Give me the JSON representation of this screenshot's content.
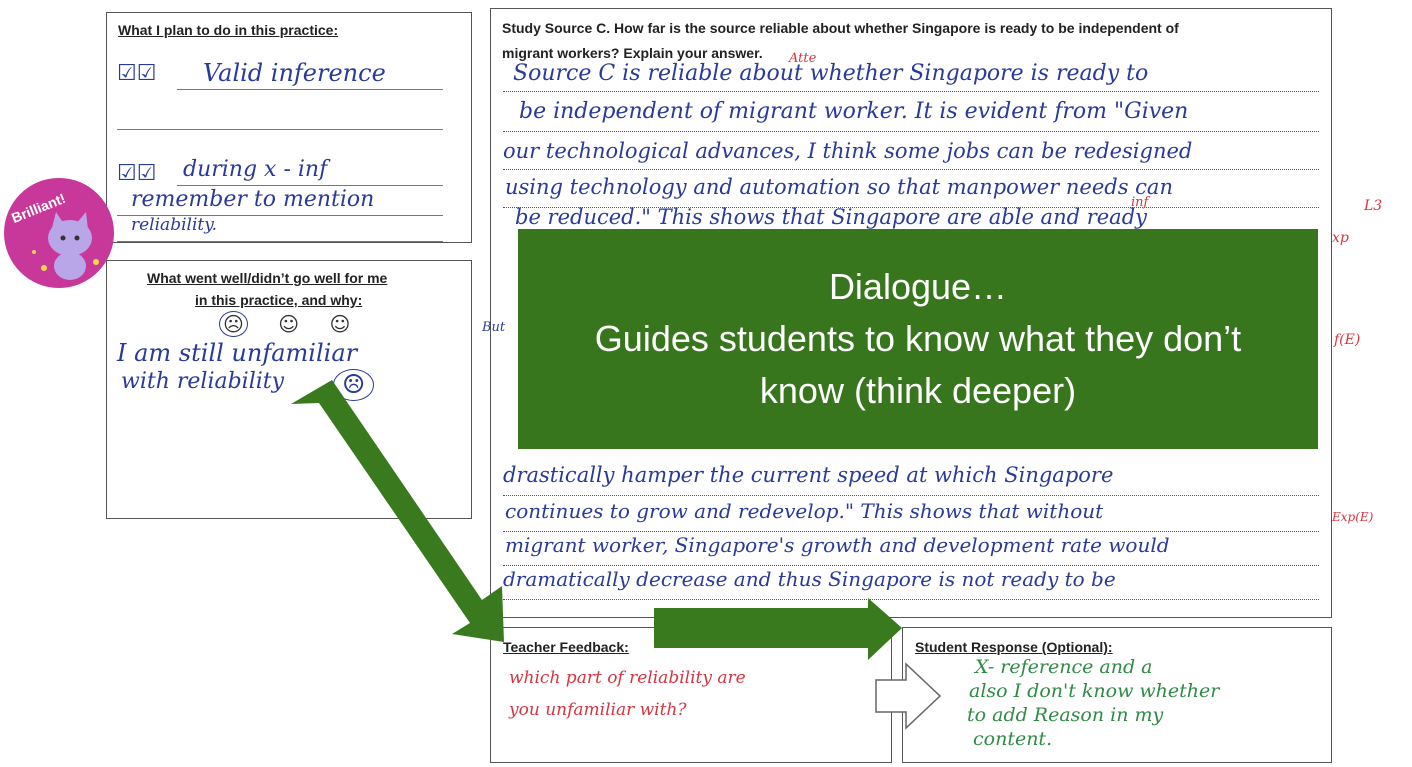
{
  "plan": {
    "title": "What I plan to do in this practice:",
    "item1": "Valid inference",
    "item2": "during x - inf",
    "item3_line1": "remember to mention",
    "item3_line2": "reliability."
  },
  "sticker": {
    "text": "Brilliant!"
  },
  "reflection": {
    "title_line1": "What went well/didn’t go well for me",
    "title_line2": "in this practice, and why:",
    "faces": [
      "☹",
      "☺",
      "☺"
    ],
    "answer_line1": "I am still unfamiliar",
    "answer_line2": "with reliability",
    "margin_note": "But"
  },
  "source": {
    "question_line1": "Study Source C. How far is the source reliable about whether Singapore is ready to be independent of",
    "question_line2": "migrant workers? Explain your answer.",
    "lines": [
      "Source C is reliable about whether Singapore is ready to",
      "be independent of migrant worker. It is evident from \"Given",
      "our technological advances, I think some jobs can be redesigned",
      "using technology and automation so that manpower needs can",
      "be reduced.\" This shows that Singapore are able and ready",
      "drastically hamper the current speed at which Singapore",
      "continues to grow and redevelop.\" This shows that without",
      "migrant worker, Singapore's growth and development rate would",
      "dramatically decrease and thus Singapore is not ready to be"
    ],
    "annotations": {
      "atte": "Atte",
      "inf": "inf",
      "l3": "L3",
      "xp": "xp",
      "fe": "f(E)",
      "expe": "Exp(E)"
    }
  },
  "overlay": {
    "line1": "Dialogue…",
    "line2": "Guides students to know what they don’t",
    "line3": "know (think deeper)"
  },
  "teacher": {
    "title": "Teacher Feedback:",
    "line1": "which part of reliability are",
    "line2": "you unfamiliar with?"
  },
  "student": {
    "title": "Student Response (Optional):",
    "line1": "X- reference and a",
    "line2": "also I don't know whether",
    "line3": "to add Reason in my",
    "line4": "content."
  },
  "colors": {
    "overlay": "#38761d",
    "arrow": "#3a7a1f",
    "ink_blue": "#2a3a9a",
    "ink_red": "#d6343f",
    "ink_green": "#2f8a46",
    "sticker": "#c8389b"
  }
}
